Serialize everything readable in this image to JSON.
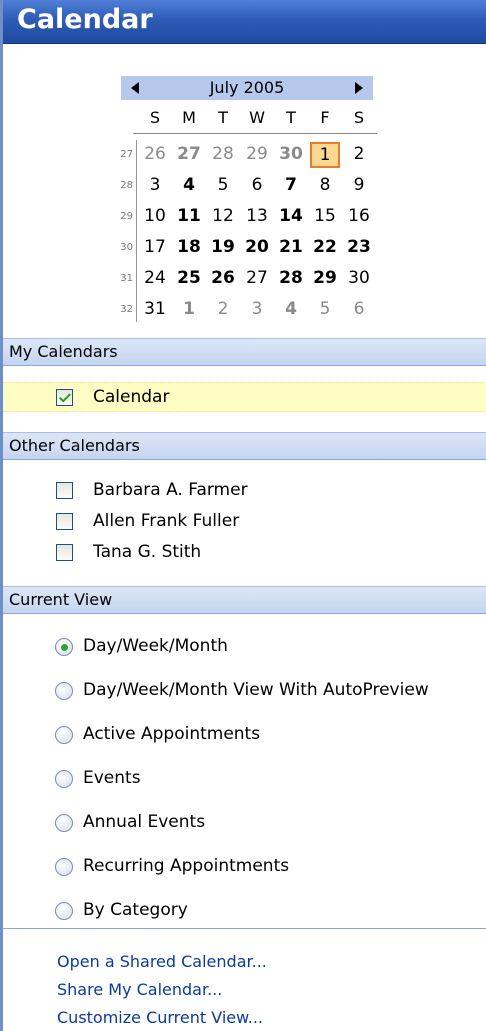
{
  "header": {
    "title": "Calendar"
  },
  "navigator": {
    "month": "July 2005",
    "day_headers": [
      "S",
      "M",
      "T",
      "W",
      "T",
      "F",
      "S"
    ],
    "weeks": [
      {
        "num": "27",
        "days": [
          {
            "d": "26",
            "other": true,
            "bold": false
          },
          {
            "d": "27",
            "other": true,
            "bold": true
          },
          {
            "d": "28",
            "other": true,
            "bold": false
          },
          {
            "d": "29",
            "other": true,
            "bold": false
          },
          {
            "d": "30",
            "other": true,
            "bold": true
          },
          {
            "d": "1",
            "other": false,
            "bold": false,
            "today": true
          },
          {
            "d": "2",
            "other": false,
            "bold": false
          }
        ]
      },
      {
        "num": "28",
        "days": [
          {
            "d": "3",
            "bold": false
          },
          {
            "d": "4",
            "bold": true
          },
          {
            "d": "5",
            "bold": false
          },
          {
            "d": "6",
            "bold": false
          },
          {
            "d": "7",
            "bold": true
          },
          {
            "d": "8",
            "bold": false
          },
          {
            "d": "9",
            "bold": false
          }
        ]
      },
      {
        "num": "29",
        "days": [
          {
            "d": "10",
            "bold": false
          },
          {
            "d": "11",
            "bold": true
          },
          {
            "d": "12",
            "bold": false
          },
          {
            "d": "13",
            "bold": false
          },
          {
            "d": "14",
            "bold": true
          },
          {
            "d": "15",
            "bold": false
          },
          {
            "d": "16",
            "bold": false
          }
        ]
      },
      {
        "num": "30",
        "days": [
          {
            "d": "17",
            "bold": false
          },
          {
            "d": "18",
            "bold": true
          },
          {
            "d": "19",
            "bold": true
          },
          {
            "d": "20",
            "bold": true
          },
          {
            "d": "21",
            "bold": true
          },
          {
            "d": "22",
            "bold": true
          },
          {
            "d": "23",
            "bold": true
          }
        ]
      },
      {
        "num": "31",
        "days": [
          {
            "d": "24",
            "bold": false
          },
          {
            "d": "25",
            "bold": true
          },
          {
            "d": "26",
            "bold": true
          },
          {
            "d": "27",
            "bold": false
          },
          {
            "d": "28",
            "bold": true
          },
          {
            "d": "29",
            "bold": true
          },
          {
            "d": "30",
            "bold": false
          }
        ]
      },
      {
        "num": "32",
        "days": [
          {
            "d": "31",
            "bold": false
          },
          {
            "d": "1",
            "other": true,
            "bold": true
          },
          {
            "d": "2",
            "other": true,
            "bold": false
          },
          {
            "d": "3",
            "other": true,
            "bold": false
          },
          {
            "d": "4",
            "other": true,
            "bold": true
          },
          {
            "d": "5",
            "other": true,
            "bold": false
          },
          {
            "d": "6",
            "other": true,
            "bold": false
          }
        ]
      }
    ]
  },
  "my_calendars": {
    "header": "My Calendars",
    "items": [
      {
        "label": "Calendar",
        "checked": true
      }
    ]
  },
  "other_calendars": {
    "header": "Other Calendars",
    "items": [
      {
        "label": "Barbara A. Farmer",
        "checked": false
      },
      {
        "label": "Allen Frank Fuller",
        "checked": false
      },
      {
        "label": "Tana G. Stith",
        "checked": false
      }
    ]
  },
  "current_view": {
    "header": "Current View",
    "options": [
      {
        "label": "Day/Week/Month",
        "selected": true
      },
      {
        "label": "Day/Week/Month View With AutoPreview",
        "selected": false
      },
      {
        "label": "Active Appointments",
        "selected": false
      },
      {
        "label": "Events",
        "selected": false
      },
      {
        "label": "Annual Events",
        "selected": false
      },
      {
        "label": "Recurring Appointments",
        "selected": false
      },
      {
        "label": "By Category",
        "selected": false
      }
    ]
  },
  "links": [
    {
      "label": "Open a Shared Calendar..."
    },
    {
      "label": "Share My Calendar..."
    },
    {
      "label": "Customize Current View..."
    }
  ],
  "colors": {
    "header_blue": "#2f5cb4",
    "selected_bg": "#fffdc4",
    "today_border": "#e07f2f",
    "link": "#0b3b9a",
    "radio_dot": "#2fa52f"
  }
}
